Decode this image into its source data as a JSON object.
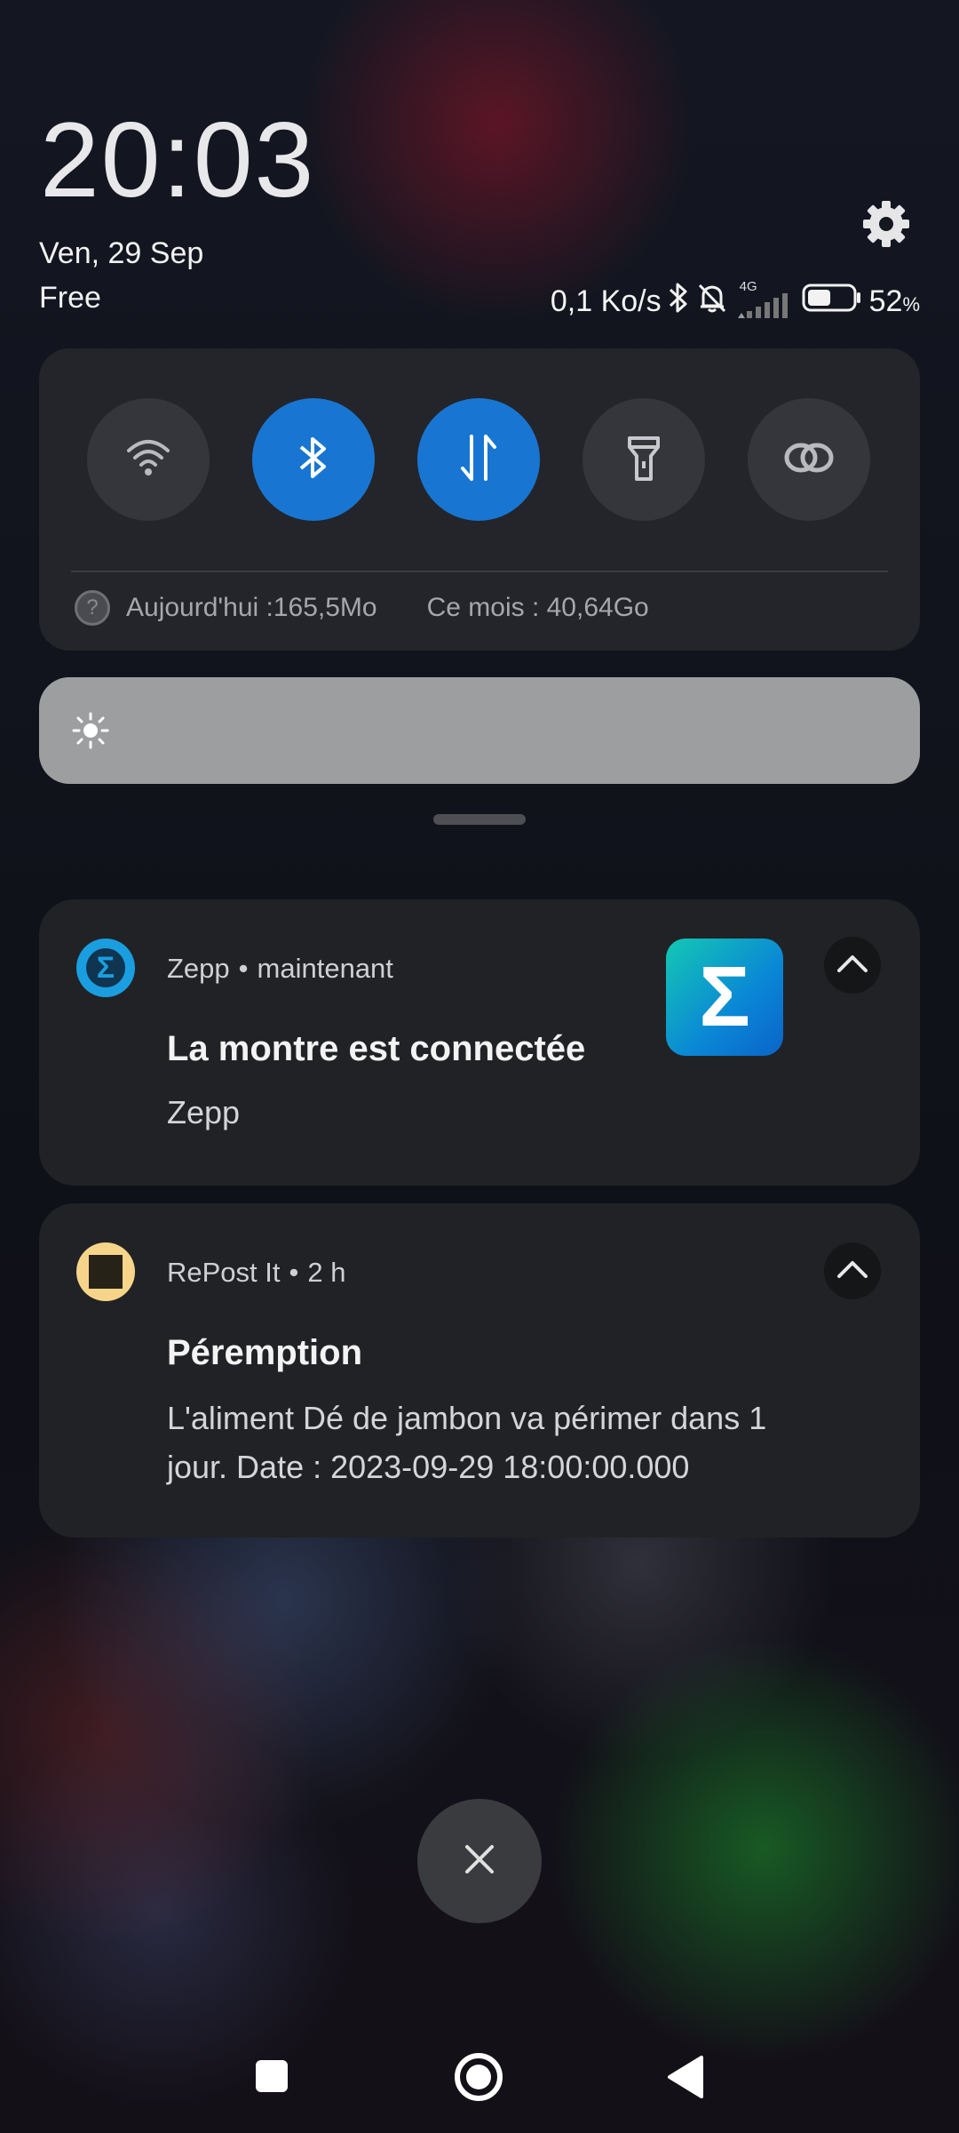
{
  "clock": {
    "time": "20:03",
    "date": "Ven, 29 Sep",
    "carrier": "Free"
  },
  "status_bar": {
    "speed": "0,1 Ko/s",
    "network_type": "4G",
    "battery_percent": "52",
    "battery_unit": "%",
    "battery_level": 0.52,
    "icons": [
      "bluetooth-icon",
      "bell-off-icon",
      "signal-icon",
      "battery-icon"
    ]
  },
  "quick_settings": {
    "tiles": [
      {
        "name": "wifi",
        "icon": "wifi-icon",
        "active": false
      },
      {
        "name": "bluetooth",
        "icon": "bluetooth-icon",
        "active": true
      },
      {
        "name": "mobile-data",
        "icon": "data-arrows-icon",
        "active": true
      },
      {
        "name": "flashlight",
        "icon": "flashlight-icon",
        "active": false
      },
      {
        "name": "link",
        "icon": "link-icon",
        "active": false
      }
    ],
    "data_usage": {
      "help_glyph": "?",
      "today": "Aujourd'hui :165,5Mo",
      "month": "Ce mois : 40,64Go"
    }
  },
  "brightness": {
    "icon": "sun-icon"
  },
  "notifications": [
    {
      "app": "Zepp",
      "separator": "•",
      "time": "maintenant",
      "title": "La montre est connectée",
      "body": "Zepp",
      "icon_glyph": "Σ",
      "accent": "#1a9ee0"
    },
    {
      "app": "RePost It",
      "separator": "•",
      "time": "2 h",
      "title": "Péremption",
      "body_line1": "L'aliment Dé de jambon  va périmer dans 1",
      "body_line2": "jour. Date : 2023-09-29 18:00:00.000",
      "accent": "#f6d58a"
    }
  ],
  "dismiss": {
    "glyph": "✕"
  },
  "navbar": {
    "icons": [
      "recents-square-icon",
      "home-circle-icon",
      "back-triangle-icon"
    ]
  }
}
